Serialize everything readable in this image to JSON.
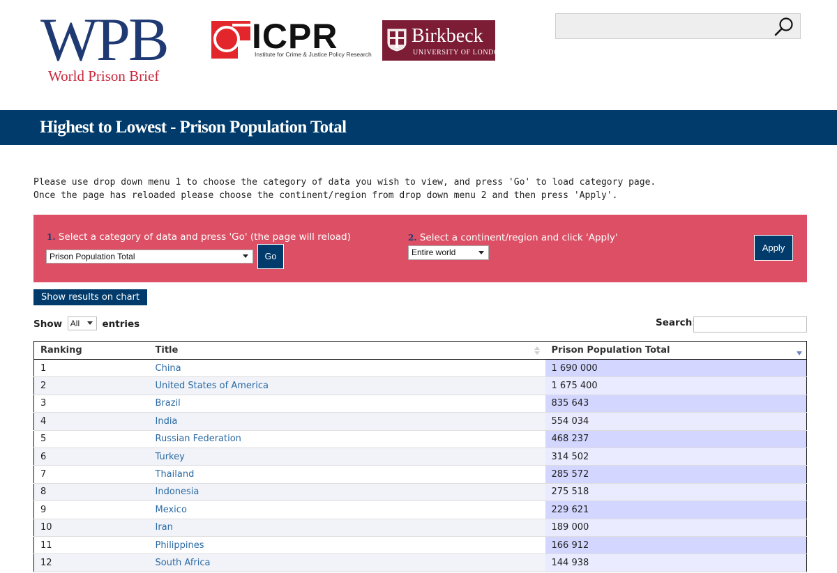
{
  "header": {
    "wpb_logo": {
      "letters": "WPB",
      "subtitle": "World Prison Brief"
    },
    "icpr_logo": {
      "letters": "ICPR",
      "subtitle": "Institute for Crime & Justice Policy Research"
    },
    "birkbeck_logo": {
      "name": "Birkbeck",
      "subtitle": "UNIVERSITY OF LONDON"
    },
    "search": {
      "placeholder": "",
      "value": ""
    }
  },
  "page_title": "Highest to Lowest - Prison Population Total",
  "intro": {
    "line1": "Please use drop down menu 1 to choose the category of data you wish to view, and press 'Go' to load category page.",
    "line2": "Once the page has reloaded please choose the continent/region from drop down menu 2 and then press 'Apply'."
  },
  "filters": {
    "step1_num": "1.",
    "step1_label": "Select a category of data and press 'Go' (the page will reload)",
    "category_selected": "Prison Population Total",
    "go_label": "Go",
    "step2_num": "2.",
    "step2_label": "Select a continent/region and click 'Apply'",
    "region_selected": "Entire world",
    "apply_label": "Apply"
  },
  "chart_button": "Show results on chart",
  "table_controls": {
    "show_label": "Show",
    "length_selected": "All",
    "entries_label": "entries",
    "search_label": "Search:"
  },
  "table": {
    "columns": [
      "Ranking",
      "Title",
      "Prison Population Total"
    ],
    "rows": [
      {
        "rank": "1",
        "title": "China",
        "value": "1 690 000"
      },
      {
        "rank": "2",
        "title": "United States of America",
        "value": "1 675 400"
      },
      {
        "rank": "3",
        "title": "Brazil",
        "value": "835 643"
      },
      {
        "rank": "4",
        "title": "India",
        "value": "554 034"
      },
      {
        "rank": "5",
        "title": "Russian Federation",
        "value": "468 237"
      },
      {
        "rank": "6",
        "title": "Turkey",
        "value": "314 502"
      },
      {
        "rank": "7",
        "title": "Thailand",
        "value": "285 572"
      },
      {
        "rank": "8",
        "title": "Indonesia",
        "value": "275 518"
      },
      {
        "rank": "9",
        "title": "Mexico",
        "value": "229 621"
      },
      {
        "rank": "10",
        "title": "Iran",
        "value": "189 000"
      },
      {
        "rank": "11",
        "title": "Philippines",
        "value": "166 912"
      },
      {
        "rank": "12",
        "title": "South Africa",
        "value": "144 938"
      }
    ]
  },
  "colors": {
    "brand_navy": "#003b6b",
    "filter_panel": "#dc4f64",
    "link_blue": "#2b6aa3",
    "sorted_column": "#d3d6ff"
  }
}
